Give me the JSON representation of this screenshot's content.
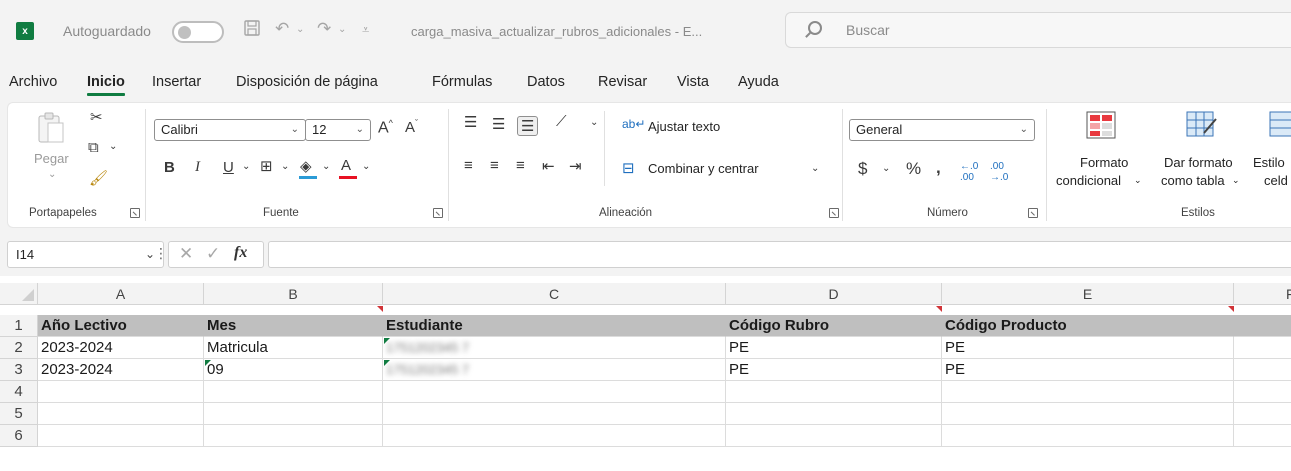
{
  "titlebar": {
    "autosave_label": "Autoguardado",
    "document_title": "carga_masiva_actualizar_rubros_adicionales - E...",
    "search_placeholder": "Buscar"
  },
  "menu": {
    "tabs": [
      "Archivo",
      "Inicio",
      "Insertar",
      "Disposición de página",
      "Fórmulas",
      "Datos",
      "Revisar",
      "Vista",
      "Ayuda"
    ],
    "active": "Inicio"
  },
  "ribbon": {
    "clipboard": {
      "label": "Portapapeles",
      "paste": "Pegar"
    },
    "font": {
      "label": "Fuente",
      "name": "Calibri",
      "size": "12"
    },
    "alignment": {
      "label": "Alineación",
      "wrap": "Ajustar texto",
      "merge": "Combinar y centrar"
    },
    "number": {
      "label": "Número",
      "format": "General"
    },
    "styles": {
      "label": "Estilos",
      "cond_format_1": "Formato",
      "cond_format_2": "condicional",
      "as_table_1": "Dar formato",
      "as_table_2": "como tabla",
      "cell_styles_1": "Estilo",
      "cell_styles_2": "celd"
    }
  },
  "formula_bar": {
    "name_box": "I14",
    "fx": "fx",
    "value": ""
  },
  "sheet": {
    "columns": [
      "A",
      "B",
      "C",
      "D",
      "E",
      "F"
    ],
    "rows": [
      "1",
      "2",
      "3",
      "4",
      "5",
      "6"
    ],
    "header": [
      "Año Lectivo",
      "Mes",
      "Estudiante",
      "Código Rubro",
      "Código Producto"
    ],
    "data": [
      [
        "2023-2024",
        "Matricula",
        "1751202345 7",
        "PE",
        "PE"
      ],
      [
        "2023-2024",
        "09",
        "1751202345 7",
        "PE",
        "PE"
      ]
    ]
  },
  "colors": {
    "accent": "#107c41",
    "header_fill": "#bfbfbf",
    "comment_indicator": "#d13438"
  }
}
